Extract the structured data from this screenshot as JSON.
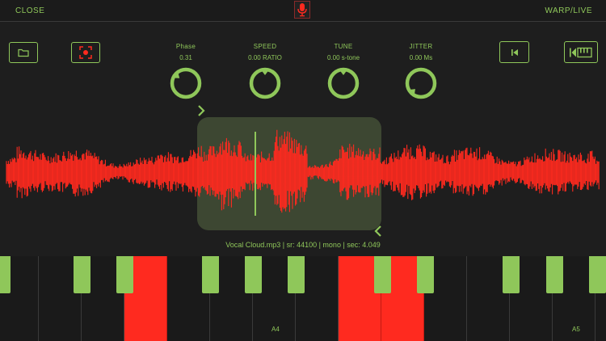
{
  "topbar": {
    "close_label": "CLOSE",
    "warp_label": "WARP/LIVE",
    "mic_icon": "microphone-icon"
  },
  "toolbar": {
    "folder_icon": "folder-icon",
    "capture_icon": "focus-capture-icon",
    "skip_start_icon": "skip-to-start-icon",
    "keyboard_icon": "keyboard-icon"
  },
  "knobs": [
    {
      "label": "Phase",
      "value": "0.31",
      "level": 0.31
    },
    {
      "label": "SPEED",
      "value": "0.00 RATIO",
      "level": 0.5
    },
    {
      "label": "TUNE",
      "value": "0.00 s-tone",
      "level": 0.5
    },
    {
      "label": "JITTER",
      "value": "0.00 Ms",
      "level": 0.0
    }
  ],
  "file_info": "Vocal Cloud.mp3 | sr: 44100 | mono  | sec: 4.049",
  "keyboard": {
    "note_labels": [
      "A4",
      "A5"
    ],
    "active_white_keys": [
      3,
      8,
      9
    ]
  },
  "colors": {
    "accent": "#8fc75a",
    "waveform": "#ff2a1f",
    "background": "#1e1e1e"
  }
}
